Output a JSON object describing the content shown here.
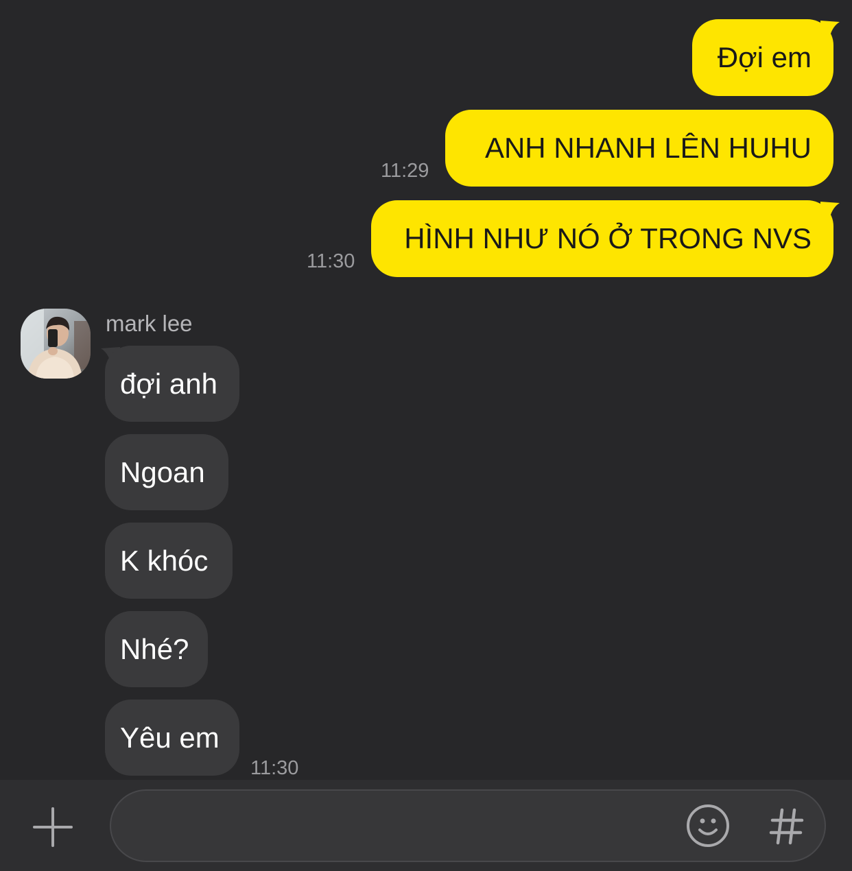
{
  "colors": {
    "background": "#272729",
    "my_bubble": "#FEE500",
    "their_bubble": "#3A3A3C",
    "timestamp": "#9B9B9E",
    "input_bar": "#2E2E30"
  },
  "outgoing": [
    {
      "text": "Đợi em",
      "time": ""
    },
    {
      "text": "ANH NHANH LÊN HUHU",
      "time": "11:29"
    },
    {
      "text": "HÌNH NHƯ NÓ Ở TRONG NVS",
      "time": "11:30"
    }
  ],
  "contact": {
    "name": "mark lee",
    "avatar_icon": "profile-photo"
  },
  "incoming": [
    {
      "text": "đợi anh"
    },
    {
      "text": "Ngoan"
    },
    {
      "text": "K khóc"
    },
    {
      "text": "Nhé?"
    },
    {
      "text": "Yêu em"
    }
  ],
  "incoming_time": "11:30",
  "input": {
    "value": "",
    "placeholder": "",
    "plus_icon": "plus-icon",
    "emoji_icon": "emoji-icon",
    "hash_icon": "hash-icon",
    "hash_label": "#"
  }
}
